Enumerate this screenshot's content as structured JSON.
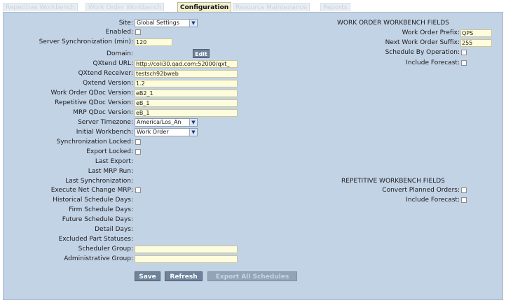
{
  "tabs": [
    {
      "label": "Repetitive Workbench",
      "active": false
    },
    {
      "label": "Work Order Workbench",
      "active": false
    },
    {
      "label": "Configuration",
      "active": true
    },
    {
      "label": "Resource Maintenance",
      "active": false
    },
    {
      "label": "Reports",
      "active": false
    }
  ],
  "left": {
    "site_label": "Site:",
    "site_value": "Global Settings",
    "enabled_label": "Enabled:",
    "server_sync_label": "Server Synchronization (min):",
    "server_sync_value": "120",
    "domain_label": "Domain:",
    "edit_button": "Edit",
    "qxtend_url_label": "QXtend URL:",
    "qxtend_url_value": "http://coli30.qad.com:52000/qxt_",
    "qxtend_receiver_label": "QXtend Receiver:",
    "qxtend_receiver_value": "testsch92bweb",
    "qxtend_version_label": "Qxtend Version:",
    "qxtend_version_value": "1.2",
    "wo_qdoc_label": "Work Order QDoc Version:",
    "wo_qdoc_value": "eB2_1",
    "rep_qdoc_label": "Repetitive QDoc Version:",
    "rep_qdoc_value": "eB_1",
    "mrp_qdoc_label": "MRP QDoc Version:",
    "mrp_qdoc_value": "eB_1",
    "timezone_label": "Server Timezone:",
    "timezone_value": "America/Los_An",
    "initial_wb_label": "Initial Workbench:",
    "initial_wb_value": "Work Order",
    "sync_locked_label": "Synchronization Locked:",
    "export_locked_label": "Export Locked:",
    "last_export_label": "Last Export:",
    "last_mrp_label": "Last MRP Run:",
    "last_sync_label": "Last Synchronization:",
    "net_change_label": "Execute Net Change MRP:",
    "hist_days_label": "Historical Schedule Days:",
    "firm_days_label": "Firm Schedule Days:",
    "future_days_label": "Future Schedule Days:",
    "detail_days_label": "Detail Days:",
    "excluded_label": "Excluded Part Statuses:",
    "sched_group_label": "Scheduler Group:",
    "admin_group_label": "Administrative Group:"
  },
  "right": {
    "wo_heading": "WORK ORDER WORKBENCH FIELDS",
    "wo_prefix_label": "Work Order Prefix:",
    "wo_prefix_value": "QPS",
    "next_suffix_label": "Next Work Order Suffix:",
    "next_suffix_value": "255",
    "sched_by_op_label": "Schedule By Operation:",
    "include_forecast_label": "Include Forecast:",
    "rep_heading": "REPETITIVE WORKBENCH FIELDS",
    "convert_planned_label": "Convert Planned Orders:",
    "rep_include_forecast_label": "Include Forecast:"
  },
  "buttons": {
    "save": "Save",
    "refresh": "Refresh",
    "export_all": "Export All Schedules"
  }
}
